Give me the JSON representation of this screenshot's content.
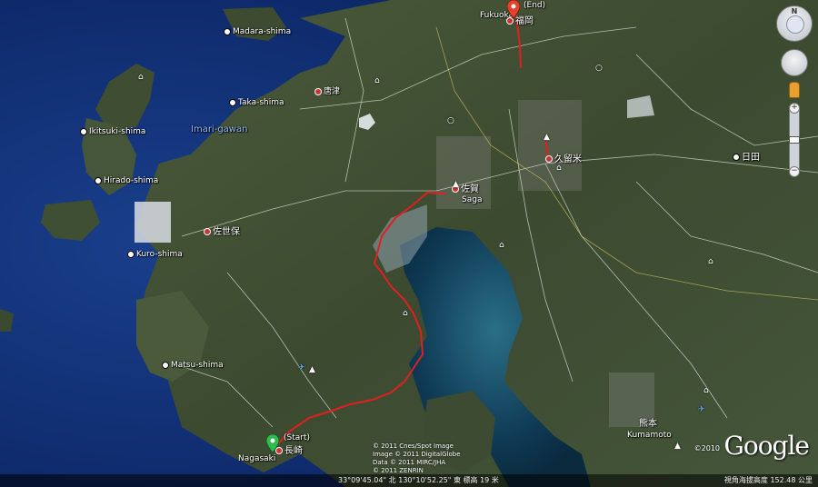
{
  "labels": {
    "madara": "Madara-shima",
    "karatsu_jp": "唐津",
    "taka": "Taka-shima",
    "imari": "Imari-gawan",
    "ikitsuki": "Ikitsuki-shima",
    "hirado": "Hirado-shima",
    "sasebo_jp": "佐世保",
    "kuro": "Kuro-shima",
    "matsu": "Matsu-shima",
    "saga_jp": "佐賀",
    "saga_en": "Saga",
    "kurume_jp": "久留米",
    "hita_jp": "日田",
    "kumamoto_jp": "熊本",
    "kumamoto_en": "Kumamoto",
    "fukuoka_en": "Fukuoka",
    "fukuoka_jp": "福岡",
    "end": "(End)",
    "start": "(Start)",
    "nagasaki_en": "Nagasaki",
    "nagasaki_jp": "長崎"
  },
  "attribution": {
    "line1": "© 2011 Cnes/Spot Image",
    "line2": "Image © 2011 DigitalGlobe",
    "line3": "Data © 2011 MIRC/JHA",
    "line4": "© 2011 ZENRIN",
    "year": "©2010",
    "brand": "Google"
  },
  "status": {
    "coords": "33°09'45.04\" 北  130°10'52.25\" 東  標高  19 米",
    "eye": "視角海拔高度  152.48 公里"
  },
  "nav": {
    "north": "N",
    "zoom_in": "+",
    "zoom_out": "−"
  },
  "colors": {
    "route": "#e02020",
    "start_pin": "#2dbb4b",
    "end_pin": "#e8412b",
    "sea": "#0d2b6b"
  }
}
